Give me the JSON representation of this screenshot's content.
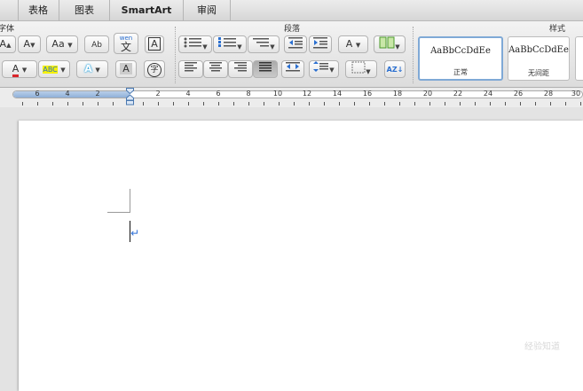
{
  "tabs": [
    "表格",
    "图表",
    "SmartArt",
    "审阅"
  ],
  "groups": {
    "font": "字体",
    "paragraph": "段落",
    "styles": "样式"
  },
  "font_buttons": {
    "grow": "A",
    "shrink": "A",
    "change_case": "Aa",
    "clear_format": "Ab",
    "phonetic_top": "wen",
    "phonetic_char": "文",
    "char_border": "A",
    "font_color": "A",
    "highlight": "ABC",
    "text_effect": "A",
    "char_shading": "A",
    "enclose": "字"
  },
  "styles": [
    {
      "sample": "AaBbCcDdEe",
      "name": "正常",
      "selected": true
    },
    {
      "sample": "AaBbCcDdEe",
      "name": "无间距",
      "selected": false
    }
  ],
  "ruler_numbers": [
    "6",
    "4",
    "2",
    "2",
    "4",
    "6",
    "8",
    "10",
    "12",
    "14",
    "16",
    "18",
    "20",
    "22",
    "24",
    "26",
    "28",
    "30"
  ],
  "paragraph_mark": "↵",
  "watermark": "经验知道"
}
